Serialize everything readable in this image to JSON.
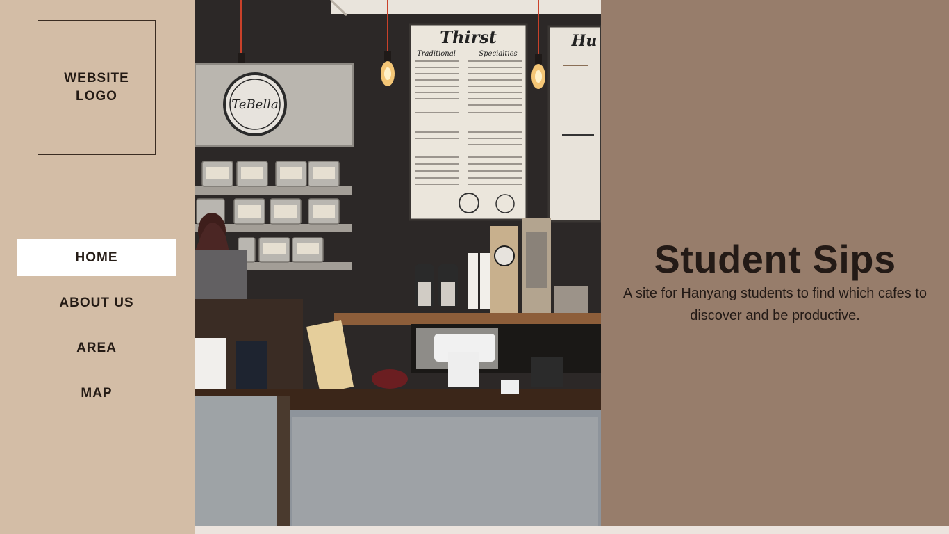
{
  "sidebar": {
    "logo_line1": "WEBSITE",
    "logo_line2": "LOGO",
    "nav": [
      {
        "label": "HOME",
        "active": true
      },
      {
        "label": "ABOUT US",
        "active": false
      },
      {
        "label": "AREA",
        "active": false
      },
      {
        "label": "MAP",
        "active": false
      }
    ]
  },
  "photo": {
    "sign_text": "TeBella",
    "menu_title": "Thirst",
    "menu_second_title": "Hu",
    "menu_left_heading": "Traditional",
    "menu_right_heading": "Specialties"
  },
  "hero": {
    "title": "Student Sips",
    "subtitle": "A site for Hanyang students to find which cafes to discover and be productive."
  },
  "colors": {
    "sidebar": "#d3bda6",
    "hero": "#977d6b",
    "active_nav": "#ffffff",
    "text": "#231a16"
  }
}
